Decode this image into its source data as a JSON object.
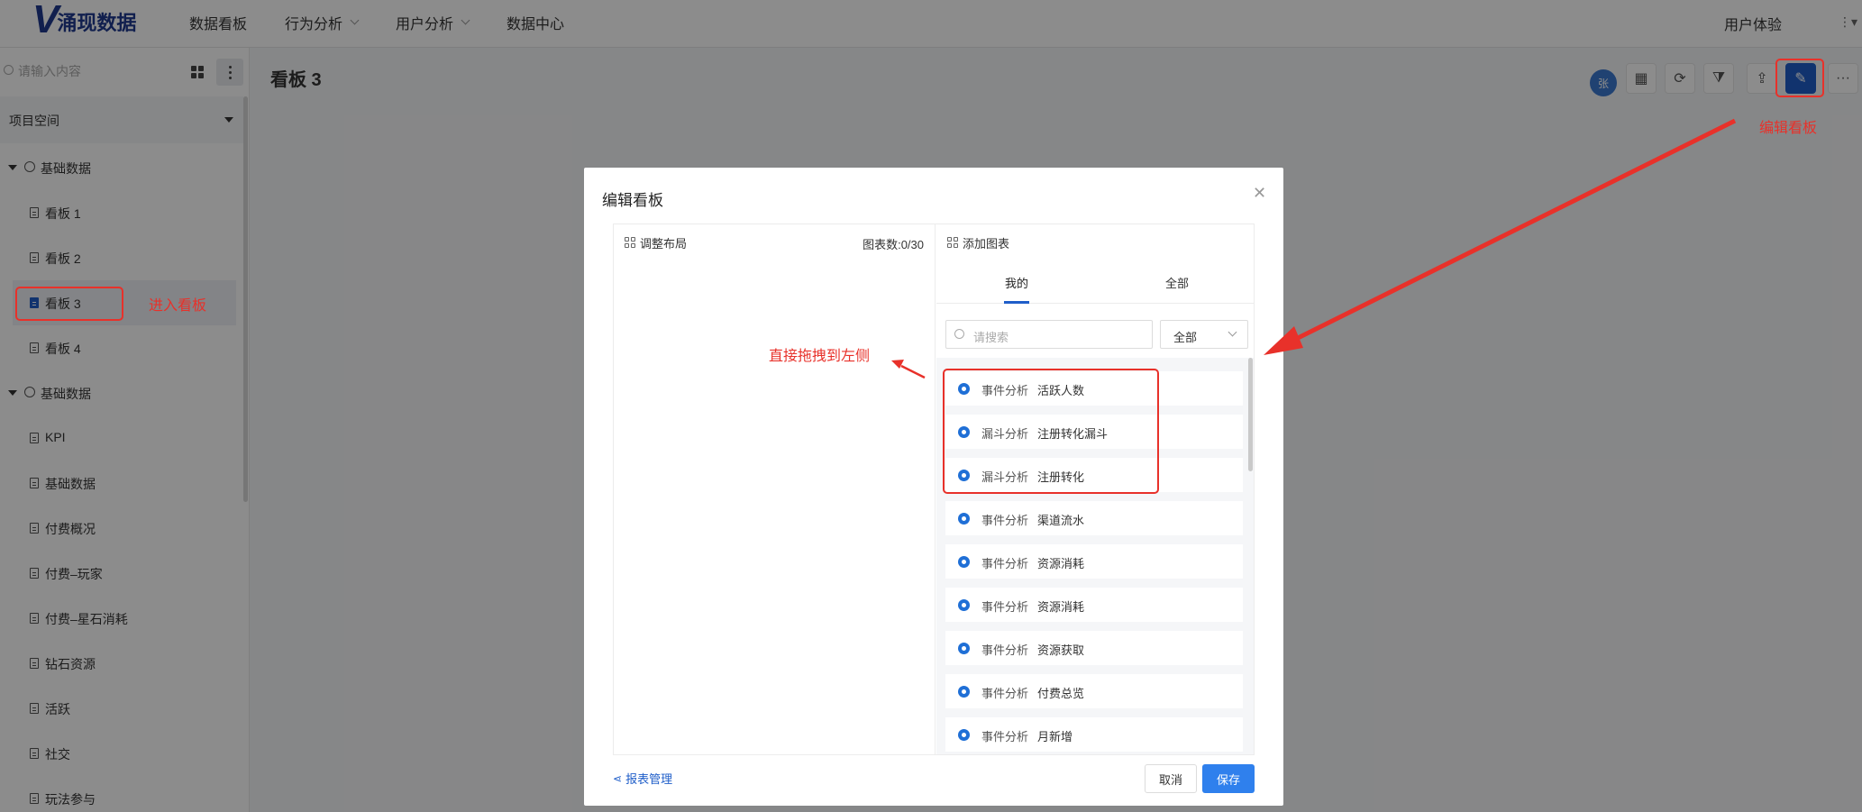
{
  "topbar": {
    "logo_mark": "V",
    "logo_text": "涌现数据",
    "nav": [
      {
        "label": "数据看板",
        "dropdown": false
      },
      {
        "label": "行为分析",
        "dropdown": true
      },
      {
        "label": "用户分析",
        "dropdown": true
      },
      {
        "label": "数据中心",
        "dropdown": false
      }
    ],
    "user_experience": "用户体验"
  },
  "sidebar": {
    "search_placeholder": "请输入内容",
    "space_label": "项目空间",
    "groups": [
      {
        "label": "基础数据",
        "items": [
          "看板 1",
          "看板 2",
          "看板 3",
          "看板 4"
        ]
      },
      {
        "label": "基础数据",
        "items": [
          "KPI",
          "基础数据",
          "付费概况",
          "付费–玩家",
          "付费–星石消耗",
          "钻石资源",
          "活跃",
          "社交",
          "玩法参与"
        ]
      }
    ],
    "active_item": "看板 3"
  },
  "main": {
    "title": "看板 3",
    "avatar_text": "张"
  },
  "modal": {
    "title": "编辑看板",
    "left_pane": {
      "title": "调整布局",
      "count": "图表数:0/30"
    },
    "right_pane": {
      "title": "添加图表",
      "tabs": [
        "我的",
        "全部"
      ],
      "active_tab": "我的",
      "search_placeholder": "请搜索",
      "filter_value": "全部",
      "items": [
        {
          "type": "事件分析",
          "name": "活跃人数"
        },
        {
          "type": "漏斗分析",
          "name": "注册转化漏斗"
        },
        {
          "type": "漏斗分析",
          "name": "注册转化"
        },
        {
          "type": "事件分析",
          "name": "渠道流水"
        },
        {
          "type": "事件分析",
          "name": "资源消耗"
        },
        {
          "type": "事件分析",
          "name": "资源消耗"
        },
        {
          "type": "事件分析",
          "name": "资源获取"
        },
        {
          "type": "事件分析",
          "name": "付费总览"
        },
        {
          "type": "事件分析",
          "name": "月新增"
        }
      ]
    },
    "footer": {
      "report_link": "报表管理",
      "cancel": "取消",
      "save": "保存"
    }
  },
  "annotations": {
    "enter_board": "进入看板",
    "edit_board": "编辑看板",
    "drag_hint": "直接拖拽到左侧"
  },
  "colors": {
    "primary": "#1f5ec9",
    "annotation_red": "#e8312a",
    "save_button": "#2f80ed"
  }
}
